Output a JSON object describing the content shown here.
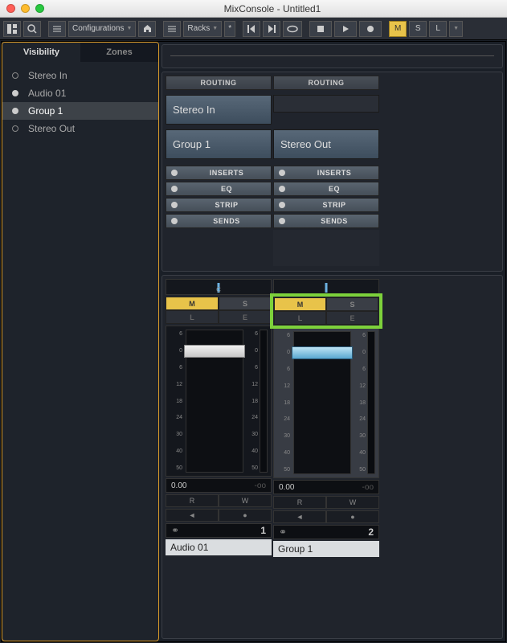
{
  "window": {
    "title": "MixConsole - Untitled1"
  },
  "traffic": {
    "close": "#ff5f57",
    "min": "#febc2e",
    "max": "#28c840"
  },
  "toolbar": {
    "configurations": "Configurations",
    "racks": "Racks",
    "m": "M",
    "s": "S",
    "l": "L"
  },
  "sidebar": {
    "tabs": {
      "visibility": "Visibility",
      "zones": "Zones"
    },
    "items": [
      {
        "label": "Stereo In",
        "filled": false,
        "selected": false
      },
      {
        "label": "Audio 01",
        "filled": true,
        "selected": false
      },
      {
        "label": "Group 1",
        "filled": true,
        "selected": true
      },
      {
        "label": "Stereo Out",
        "filled": false,
        "selected": false
      }
    ]
  },
  "headers": {
    "routing": "ROUTING",
    "inserts": "INSERTS",
    "eq": "EQ",
    "strip": "STRIP",
    "sends": "SENDS"
  },
  "channels": [
    {
      "name": "Audio 01",
      "input": "Stereo In",
      "output": "Group 1",
      "pan": "C",
      "mute": "M",
      "solo": "S",
      "listen": "L",
      "edit": "E",
      "mute_on": true,
      "value": "0.00",
      "peak": "-oo",
      "read": "R",
      "write": "W",
      "num": "1",
      "highlight": false,
      "fader_white": true
    },
    {
      "name": "Group 1",
      "input": "",
      "output": "Stereo Out",
      "pan": "",
      "mute": "M",
      "solo": "S",
      "listen": "L",
      "edit": "E",
      "mute_on": true,
      "value": "0.00",
      "peak": "-oo",
      "read": "R",
      "write": "W",
      "num": "2",
      "highlight": true,
      "fader_white": false
    }
  ],
  "scale": [
    "6",
    "0",
    "6",
    "12",
    "18",
    "24",
    "30",
    "40",
    "50"
  ]
}
